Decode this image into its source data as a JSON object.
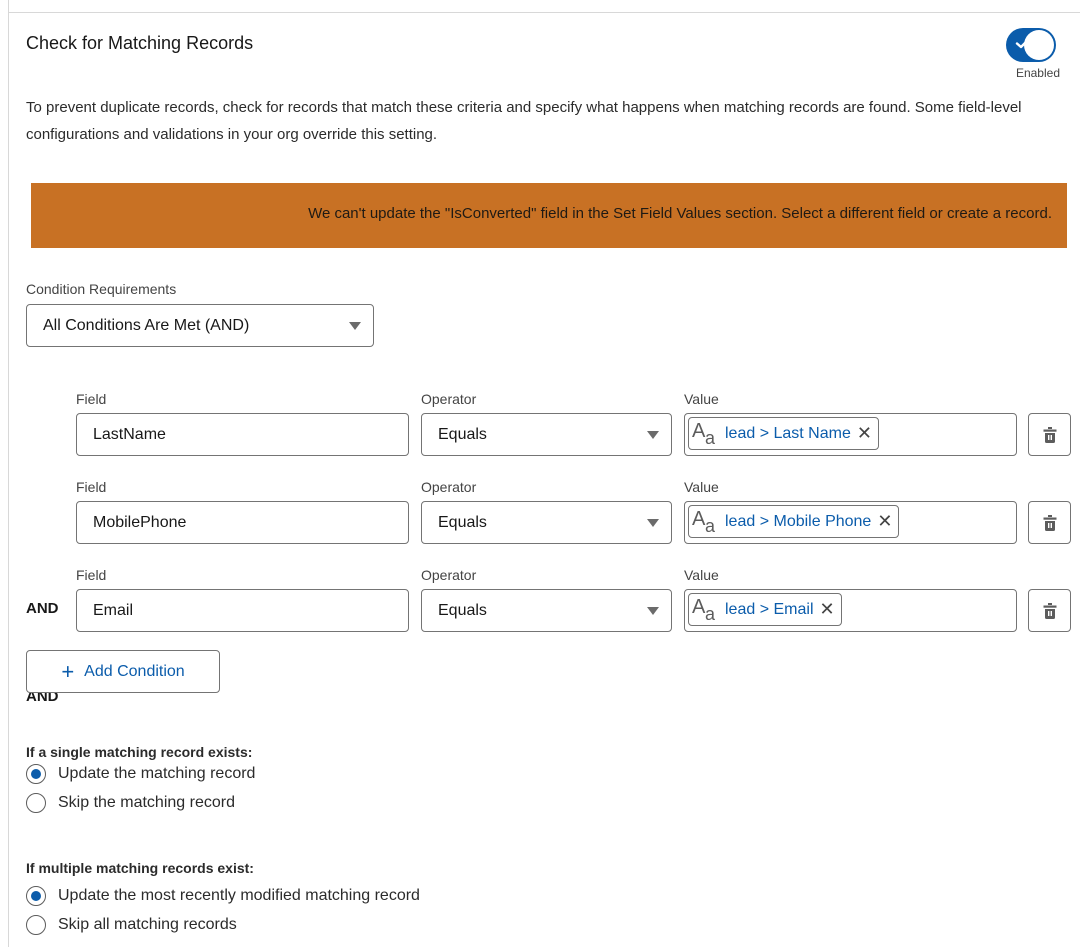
{
  "section": {
    "title": "Check for Matching Records",
    "toggle": {
      "state": "on",
      "label": "Enabled"
    },
    "description": "To prevent duplicate records, check for records that match these criteria and specify what happens when matching records are found. Some field-level configurations and validations in your org override this setting."
  },
  "warning_banner": {
    "text": "We can't update the \"IsConverted\" field in the Set Field Values section. Select a different field or create a record.",
    "color": "#c87124"
  },
  "condition_requirements": {
    "label": "Condition Requirements",
    "selected": "All Conditions Are Met (AND)"
  },
  "conditions": [
    {
      "connector": "",
      "field_label": "Field",
      "field": "LastName",
      "operator_label": "Operator",
      "operator": "Equals",
      "value_label": "Value",
      "value": "lead > Last Name"
    },
    {
      "connector": "AND",
      "field_label": "Field",
      "field": "MobilePhone",
      "operator_label": "Operator",
      "operator": "Equals",
      "value_label": "Value",
      "value": "lead > Mobile Phone"
    },
    {
      "connector": "AND",
      "field_label": "Field",
      "field": "Email",
      "operator_label": "Operator",
      "operator": "Equals",
      "value_label": "Value",
      "value": "lead > Email"
    }
  ],
  "add_condition_label": "Add Condition",
  "single_match": {
    "heading": "If a single matching record exists:",
    "options": [
      {
        "label": "Update the matching record",
        "selected": true
      },
      {
        "label": "Skip the matching record",
        "selected": false
      }
    ]
  },
  "multiple_match": {
    "heading": "If multiple matching records exist:",
    "options": [
      {
        "label": "Update the most recently modified matching record",
        "selected": true
      },
      {
        "label": "Skip all matching records",
        "selected": false
      }
    ]
  },
  "colors": {
    "brand": "#0b5cab",
    "warning": "#c87124"
  }
}
